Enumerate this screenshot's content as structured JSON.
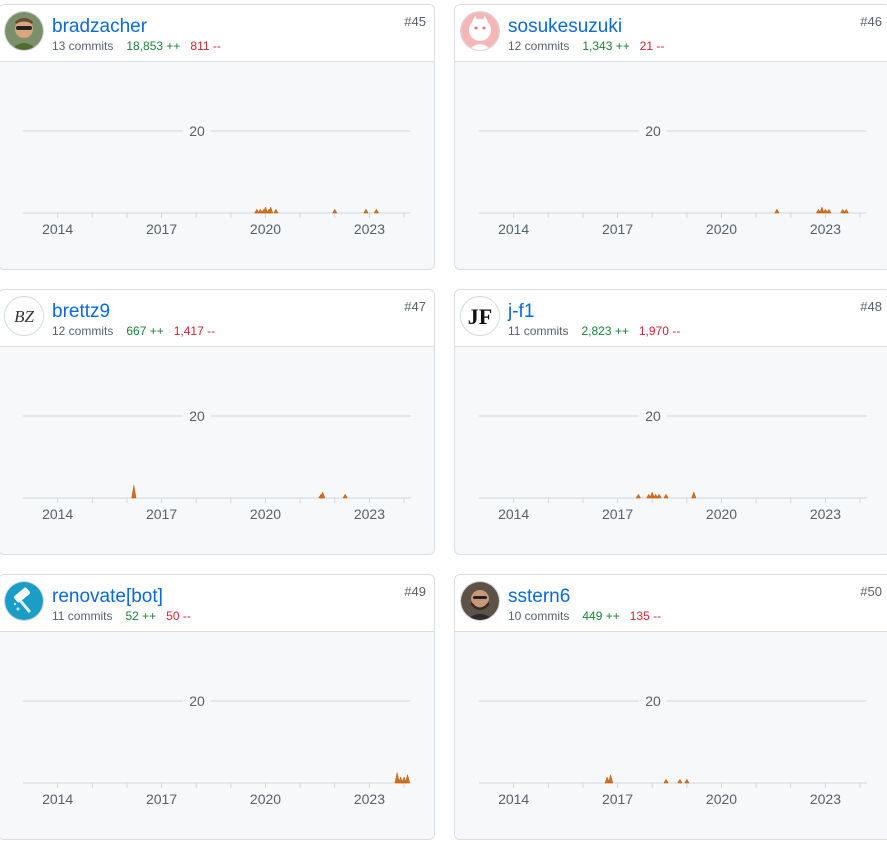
{
  "theme": {
    "link": "#0969da",
    "additions": "#1a7f37",
    "deletions": "#cf222e",
    "commit_fill": "#d96f1c",
    "chart_bg": "#f6f8fa"
  },
  "contributors": [
    {
      "rank": "#45",
      "username": "bradzacher",
      "avatar_icon": "person-photo-icon",
      "commits": "13 commits",
      "additions": "18,853 ++",
      "deletions": "811 --",
      "chart_data": {
        "type": "area",
        "ylabel": "",
        "ylim": [
          0,
          30
        ],
        "y_ticks": [
          "20"
        ],
        "x_ticks": [
          "2014",
          "2017",
          "2020",
          "2023"
        ],
        "points": [
          [
            2019.75,
            1
          ],
          [
            2019.85,
            1
          ],
          [
            2019.95,
            1
          ],
          [
            2020.0,
            2
          ],
          [
            2020.1,
            1
          ],
          [
            2020.15,
            2
          ],
          [
            2020.3,
            1
          ],
          [
            2022.0,
            1
          ],
          [
            2022.9,
            1
          ],
          [
            2023.2,
            1
          ]
        ]
      }
    },
    {
      "rank": "#46",
      "username": "sosukesuzuki",
      "avatar_icon": "cat-sketch-icon",
      "commits": "12 commits",
      "additions": "1,343 ++",
      "deletions": "21 --",
      "chart_data": {
        "type": "area",
        "ylabel": "",
        "ylim": [
          0,
          30
        ],
        "y_ticks": [
          "20"
        ],
        "x_ticks": [
          "2014",
          "2017",
          "2020",
          "2023"
        ],
        "points": [
          [
            2021.6,
            1
          ],
          [
            2022.8,
            1
          ],
          [
            2022.9,
            2
          ],
          [
            2023.0,
            1
          ],
          [
            2023.1,
            1
          ],
          [
            2023.5,
            1
          ],
          [
            2023.6,
            1
          ]
        ]
      }
    },
    {
      "rank": "#47",
      "username": "brettz9",
      "avatar_icon": "bz-logo-icon",
      "commits": "12 commits",
      "additions": "667 ++",
      "deletions": "1,417 --",
      "chart_data": {
        "type": "area",
        "ylabel": "",
        "ylim": [
          0,
          30
        ],
        "y_ticks": [
          "20"
        ],
        "x_ticks": [
          "2014",
          "2017",
          "2020",
          "2023"
        ],
        "points": [
          [
            2016.2,
            5
          ],
          [
            2021.6,
            1
          ],
          [
            2021.65,
            2
          ],
          [
            2022.3,
            1
          ]
        ]
      }
    },
    {
      "rank": "#48",
      "username": "j-f1",
      "avatar_icon": "jf-logo-icon",
      "commits": "11 commits",
      "additions": "2,823 ++",
      "deletions": "1,970 --",
      "chart_data": {
        "type": "area",
        "ylabel": "",
        "ylim": [
          0,
          30
        ],
        "y_ticks": [
          "20"
        ],
        "x_ticks": [
          "2014",
          "2017",
          "2020",
          "2023"
        ],
        "points": [
          [
            2017.6,
            1
          ],
          [
            2017.9,
            1
          ],
          [
            2018.0,
            2
          ],
          [
            2018.1,
            1
          ],
          [
            2018.2,
            1
          ],
          [
            2018.4,
            1
          ],
          [
            2019.2,
            2
          ]
        ]
      }
    },
    {
      "rank": "#49",
      "username": "renovate[bot]",
      "avatar_icon": "paint-roller-icon",
      "commits": "11 commits",
      "additions": "52 ++",
      "deletions": "50 --",
      "chart_data": {
        "type": "area",
        "ylabel": "",
        "ylim": [
          0,
          30
        ],
        "y_ticks": [
          "20"
        ],
        "x_ticks": [
          "2014",
          "2017",
          "2020",
          "2023"
        ],
        "points": [
          [
            2023.8,
            4
          ],
          [
            2023.9,
            2
          ],
          [
            2024.0,
            2
          ],
          [
            2024.1,
            3
          ]
        ]
      }
    },
    {
      "rank": "#50",
      "username": "sstern6",
      "avatar_icon": "person-photo-icon",
      "commits": "10 commits",
      "additions": "449 ++",
      "deletions": "135 --",
      "chart_data": {
        "type": "area",
        "ylabel": "",
        "ylim": [
          0,
          30
        ],
        "y_ticks": [
          "20"
        ],
        "x_ticks": [
          "2014",
          "2017",
          "2020",
          "2023"
        ],
        "points": [
          [
            2016.7,
            2
          ],
          [
            2016.8,
            3
          ],
          [
            2018.4,
            1
          ],
          [
            2018.8,
            1
          ],
          [
            2019.0,
            1
          ]
        ]
      }
    }
  ]
}
